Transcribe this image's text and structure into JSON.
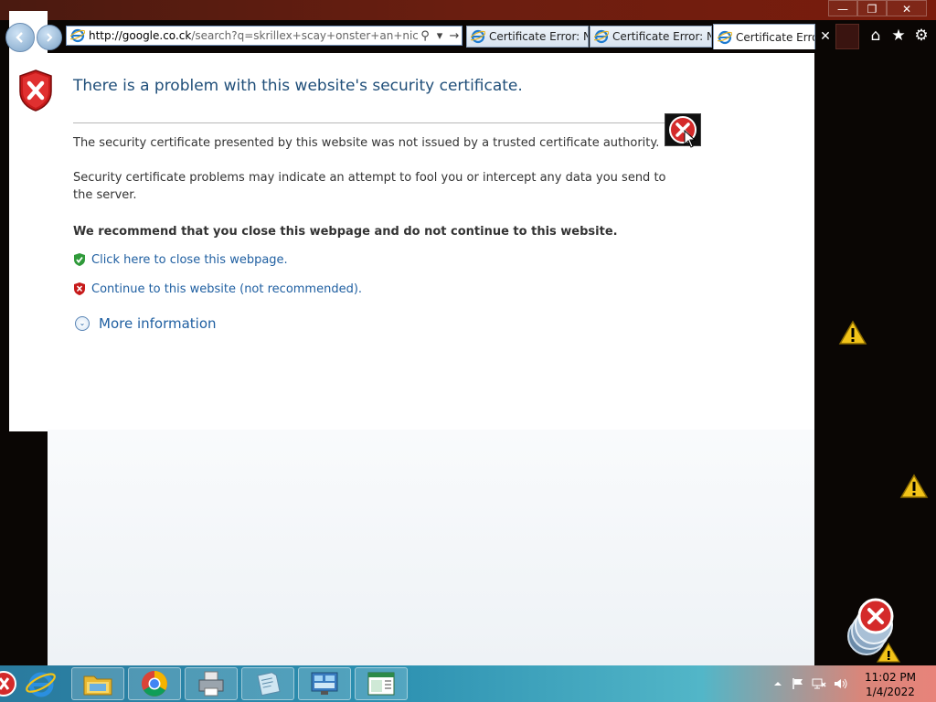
{
  "window": {
    "minimize_glyph": "—",
    "restore_glyph": "❐",
    "close_glyph": "✕"
  },
  "navbar": {
    "address_host": "http://google.co.ck",
    "address_rest": "/search?q=skrillex+scay+onster+an+nice+sprite",
    "search_glyph": "⚲",
    "dropdown_glyph": "▾",
    "go_glyph": "→",
    "tabs": [
      {
        "label": "Certificate Error: N..."
      },
      {
        "label": "Certificate Error: N..."
      },
      {
        "label": "Certificate Erro..."
      }
    ],
    "tab_close_glyph": "✕",
    "home_glyph": "⌂",
    "favorites_glyph": "★",
    "tools_glyph": "⚙"
  },
  "page": {
    "title": "There is a problem with this website's security certificate.",
    "para1": "The security certificate presented by this website was not issued by a trusted certificate authority.",
    "para2": "Security certificate problems may indicate an attempt to fool you or intercept any data you send to the server.",
    "recommend": "We recommend that you close this webpage and do not continue to this website.",
    "close_link": "Click here to close this webpage.",
    "continue_link": "Continue to this website (not recommended).",
    "more_info": "More information",
    "more_info_glyph": "⌄"
  },
  "taskbar": {
    "icons": [
      "internet-explorer-icon",
      "file-explorer-icon",
      "chrome-icon",
      "printer-icon",
      "notepad-icon",
      "control-panel-icon",
      "window-icon"
    ],
    "time": "11:02 PM",
    "date": "1/4/2022"
  },
  "colors": {
    "title": "#1f4e79",
    "link": "#1f5fa1",
    "error_red": "#c8102e"
  }
}
